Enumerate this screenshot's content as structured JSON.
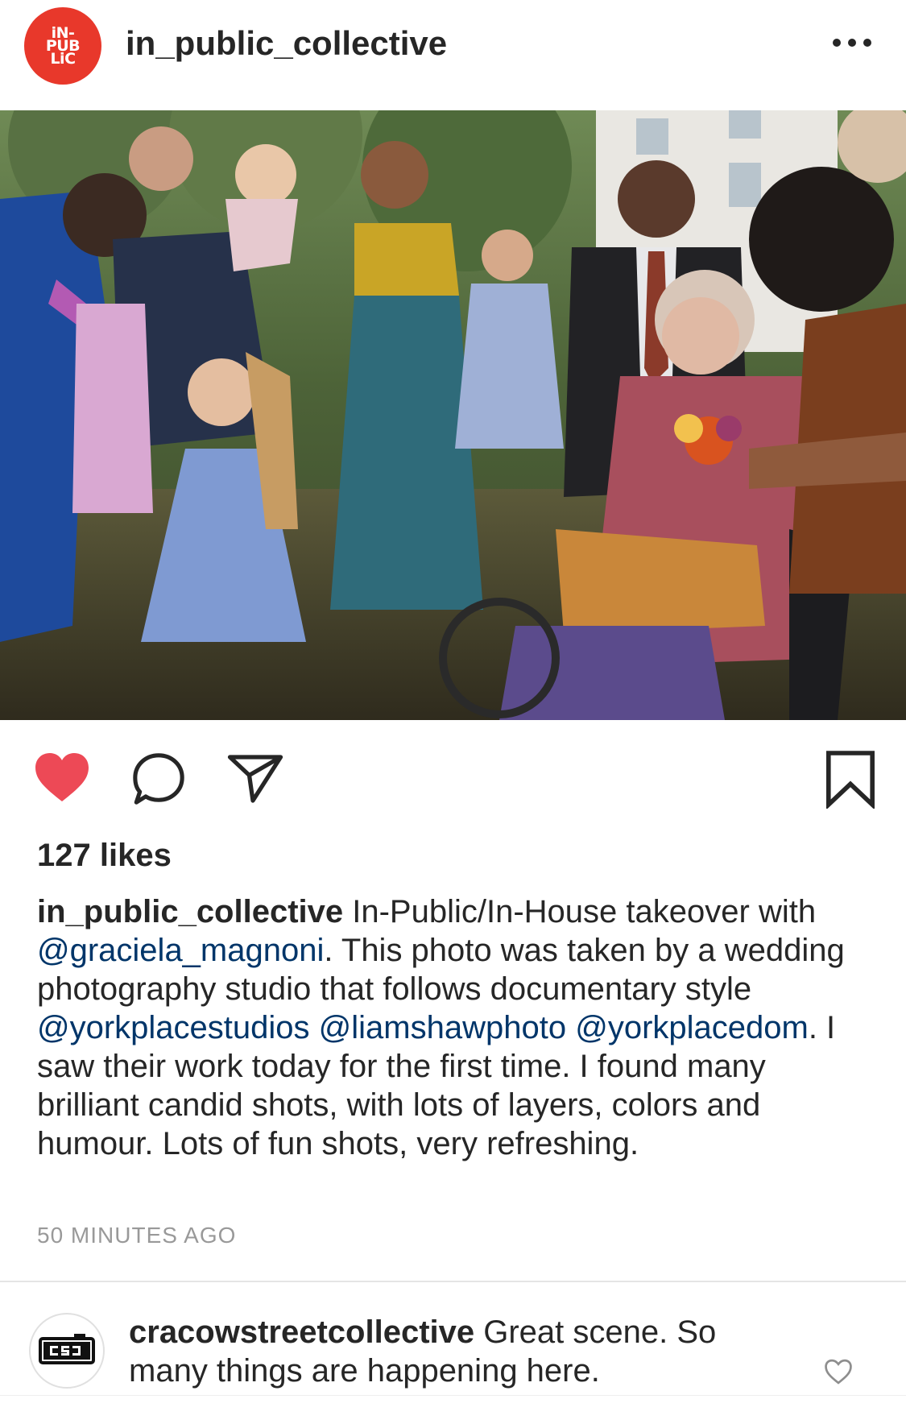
{
  "post": {
    "username": "in_public_collective",
    "avatar_lines": [
      "iN-",
      "PUB",
      "LiC"
    ],
    "more_icon": "more-horizontal-icon",
    "likes": "127 likes",
    "caption": {
      "username": "in_public_collective",
      "parts": [
        {
          "type": "text",
          "value": " In-Public/In-House takeover with "
        },
        {
          "type": "mention",
          "value": "@graciela_magnoni"
        },
        {
          "type": "text",
          "value": ". This photo was taken by a wedding photography studio that follows documentary style "
        },
        {
          "type": "mention",
          "value": "@yorkplacestudios"
        },
        {
          "type": "text",
          "value": " "
        },
        {
          "type": "mention",
          "value": "@liamshawphoto"
        },
        {
          "type": "text",
          "value": " "
        },
        {
          "type": "mention",
          "value": "@yorkplacedom"
        },
        {
          "type": "text",
          "value": ". I saw their work today for the first time. I found many brilliant candid shots, with lots of layers, colors and humour. Lots of fun shots, very refreshing."
        }
      ]
    },
    "timestamp": "50 MINUTES AGO",
    "liked": true
  },
  "actions": {
    "icons": [
      "heart-filled-icon",
      "comment-icon",
      "share-icon",
      "bookmark-icon"
    ]
  },
  "comment": {
    "username": "cracowstreetcollective",
    "text": " Great scene. So many things are happening here.",
    "avatar_text": "CSC"
  },
  "colors": {
    "avatar_bg": "#e8382b",
    "heart": "#ed4956",
    "mention": "#003569",
    "timestamp": "#999999"
  }
}
